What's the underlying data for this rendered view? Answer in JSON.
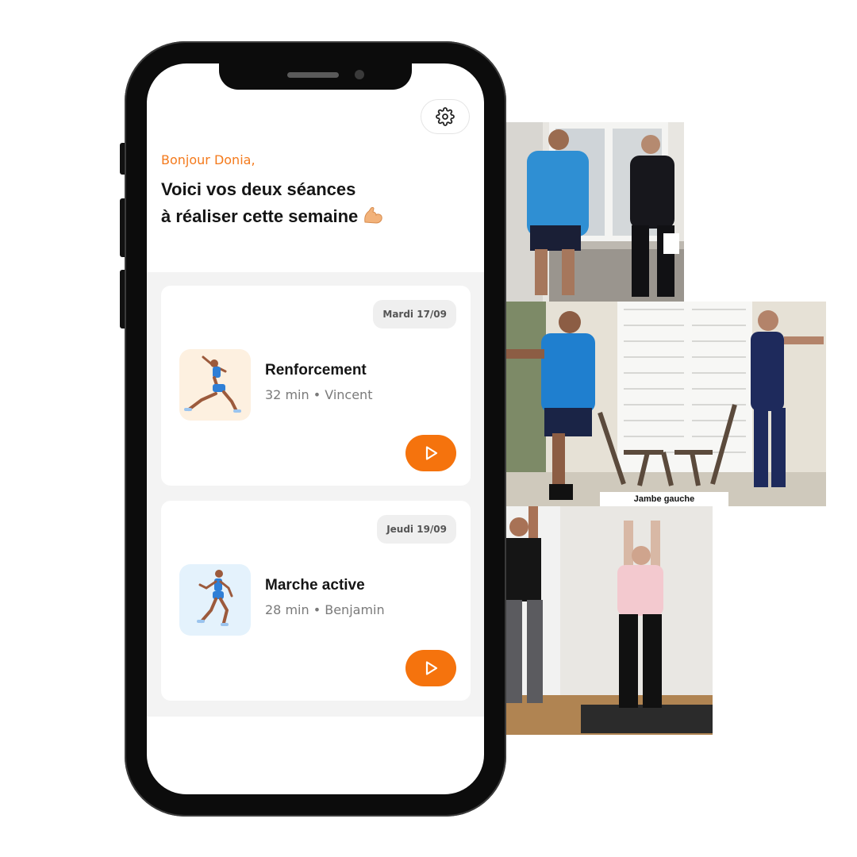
{
  "greeting": "Bonjour Donia,",
  "title": {
    "line1": "Voici vos deux séances",
    "line2": "à réaliser cette semaine"
  },
  "icons": {
    "settings": "gear-icon",
    "title_emoji": "flexed-biceps-icon",
    "play": "play-icon"
  },
  "sessions": [
    {
      "date": "Mardi 17/09",
      "name": "Renforcement",
      "meta": "32 min • Vincent",
      "thumb_bg": "#fdf0e0"
    },
    {
      "date": "Jeudi 19/09",
      "name": "Marche active",
      "meta": "28 min • Benjamin",
      "thumb_bg": "#e4f2fc"
    }
  ],
  "photos": {
    "caption_2": "Jambe gauche"
  },
  "colors": {
    "accent": "#f5730d",
    "greeting": "#f47a1c",
    "panel_bg": "#f3f3f3"
  }
}
